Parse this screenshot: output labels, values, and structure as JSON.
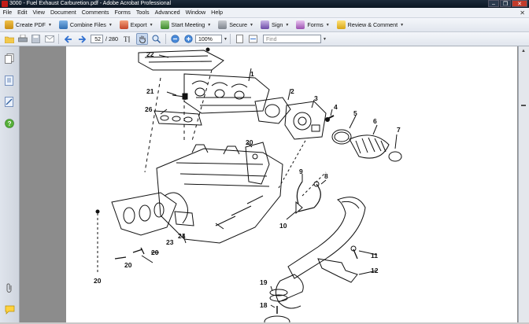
{
  "window": {
    "title": "3000 - Fuel Exhaust Carburetion.pdf - Adobe Acrobat Professional",
    "minimize": "–",
    "maximize": "❐",
    "close": "✕"
  },
  "menu": {
    "items": [
      "File",
      "Edit",
      "View",
      "Document",
      "Comments",
      "Forms",
      "Tools",
      "Advanced",
      "Window",
      "Help"
    ],
    "doc_close": "✕"
  },
  "toolbar": {
    "create_pdf": "Create PDF",
    "combine_files": "Combine Files",
    "export": "Export",
    "start_meeting": "Start Meeting",
    "secure": "Secure",
    "sign": "Sign",
    "forms": "Forms",
    "review_comment": "Review & Comment"
  },
  "nav": {
    "page_current": "52",
    "page_total": "/ 280",
    "zoom": "100%",
    "find_placeholder": "Find"
  },
  "diagram": {
    "labels": [
      "22",
      "1",
      "2",
      "3",
      "4",
      "5",
      "6",
      "7",
      "21",
      "26",
      "20",
      "9",
      "8",
      "10",
      "24",
      "23",
      "20",
      "20",
      "20",
      "11",
      "12",
      "19",
      "18"
    ]
  },
  "colors": {
    "titlebar": "#0b1622",
    "toolbar": "#e1e6ee",
    "viewer_bg": "#8c8c8c",
    "page": "#ffffff"
  }
}
